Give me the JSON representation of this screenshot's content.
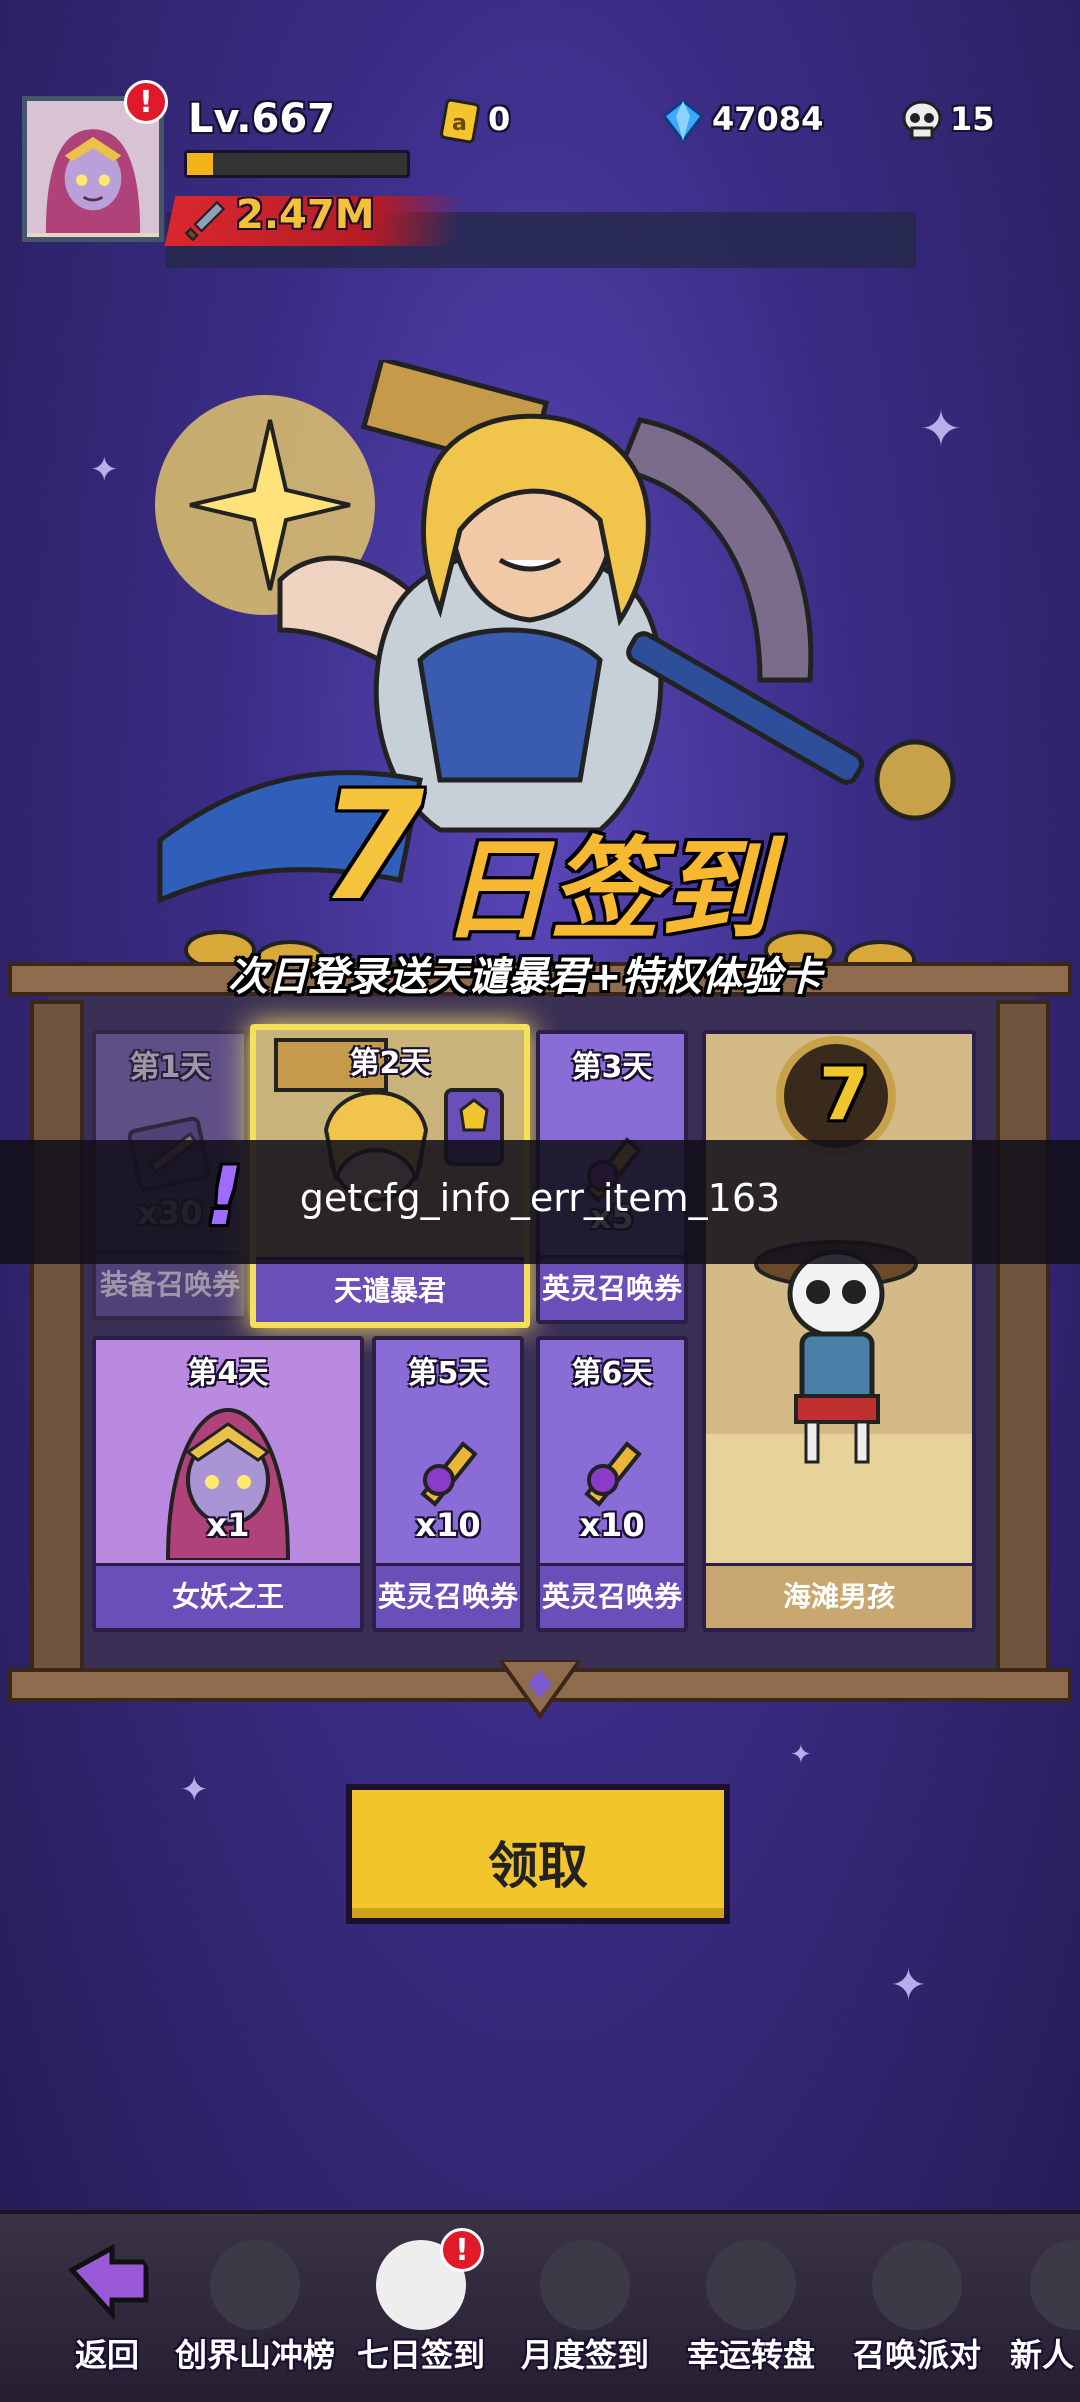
{
  "player": {
    "level": "Lv.667",
    "power": "2.47M",
    "xp_progress": 0.12
  },
  "currencies": {
    "tickets": "0",
    "gems": "47084",
    "skulls": "15"
  },
  "event": {
    "title_number": "7",
    "title_text": "日签到",
    "subtitle": "次日登录送天谴暴君+特权体验卡"
  },
  "days": [
    {
      "label": "第1天",
      "name": "装备召唤券",
      "qty": "x30",
      "state": "claimed"
    },
    {
      "label": "第2天",
      "name": "天谴暴君",
      "qty": "",
      "state": "current"
    },
    {
      "label": "第3天",
      "name": "英灵召唤券",
      "qty": "x5",
      "state": "pending"
    },
    {
      "label": "第4天",
      "name": "女妖之王",
      "qty": "x1",
      "state": "pending"
    },
    {
      "label": "第5天",
      "name": "英灵召唤券",
      "qty": "x10",
      "state": "pending"
    },
    {
      "label": "第6天",
      "name": "英灵召唤券",
      "qty": "x10",
      "state": "pending"
    },
    {
      "label": "7",
      "name": "海滩男孩",
      "qty": "",
      "state": "grand"
    }
  ],
  "error_toast": "getcfg_info_err_item_163",
  "claim_button": "领取",
  "nav": [
    {
      "label": "返回",
      "icon": "back-arrow-icon"
    },
    {
      "label": "创界山冲榜",
      "icon": "rank-icon"
    },
    {
      "label": "七日签到",
      "icon": "seven-day-icon"
    },
    {
      "label": "月度签到",
      "icon": "calendar-icon"
    },
    {
      "label": "幸运转盘",
      "icon": "wheel-icon"
    },
    {
      "label": "召唤派对",
      "icon": "disco-icon"
    },
    {
      "label": "新人",
      "icon": "newbie-icon"
    }
  ],
  "colors": {
    "accent_gold": "#f3c52c",
    "card_purple": "#8a6cd6",
    "alert_red": "#e01a2a"
  }
}
